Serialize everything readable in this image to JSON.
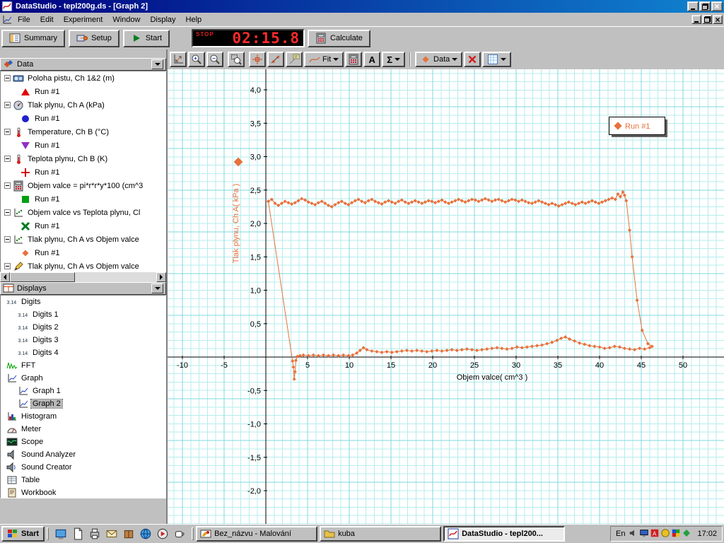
{
  "window": {
    "title": "DataStudio - tepl200g.ds - [Graph 2]"
  },
  "menubar": {
    "items": [
      "File",
      "Edit",
      "Experiment",
      "Window",
      "Display",
      "Help"
    ]
  },
  "main_toolbar": {
    "summary_label": "Summary",
    "setup_label": "Setup",
    "start_label": "Start",
    "timer": {
      "status": "STOP",
      "value": "02:15.8"
    },
    "calculate_label": "Calculate"
  },
  "graph_toolbar": {
    "fit_label": "Fit",
    "text_tool_label": "A",
    "stats_label": "Σ",
    "data_label": "Data"
  },
  "data_panel": {
    "title": "Data",
    "items": [
      {
        "icon": "motion-sensor",
        "label": "Poloha pistu, Ch 1&2 (m)",
        "runs": [
          {
            "marker": "tri-red",
            "label": "Run #1"
          }
        ]
      },
      {
        "icon": "pressure-sensor",
        "label": "Tlak plynu, Ch A (kPa)",
        "runs": [
          {
            "marker": "circle-blue",
            "label": "Run #1"
          }
        ]
      },
      {
        "icon": "temp-sensor",
        "label": "Temperature, Ch B (°C)",
        "runs": [
          {
            "marker": "tri-violet",
            "label": "Run #1"
          }
        ]
      },
      {
        "icon": "temp-sensor",
        "label": "Teplota plynu, Ch B (K)",
        "runs": [
          {
            "marker": "plus-red",
            "label": "Run #1"
          }
        ]
      },
      {
        "icon": "calculator",
        "label": "Objem valce = pi*r*r*y*100 (cm^3",
        "runs": [
          {
            "marker": "square-green",
            "label": "Run #1"
          }
        ]
      },
      {
        "icon": "xy-data",
        "label": "Objem valce vs Teplota plynu, Cl",
        "runs": [
          {
            "marker": "x-green",
            "label": "Run #1"
          }
        ]
      },
      {
        "icon": "xy-data",
        "label": "Tlak plynu, Ch A vs Objem valce",
        "runs": [
          {
            "marker": "diamond-orange",
            "label": "Run #1"
          }
        ]
      },
      {
        "icon": "pen",
        "label": "Tlak plynu, Ch A vs Objem valce",
        "runs": []
      }
    ]
  },
  "displays_panel": {
    "title": "Displays",
    "items": [
      {
        "icon": "digits",
        "label": "Digits",
        "indent": 0
      },
      {
        "icon": "digits",
        "label": "Digits 1",
        "indent": 1
      },
      {
        "icon": "digits",
        "label": "Digits 2",
        "indent": 1
      },
      {
        "icon": "digits",
        "label": "Digits 3",
        "indent": 1
      },
      {
        "icon": "digits",
        "label": "Digits 4",
        "indent": 1
      },
      {
        "icon": "fft",
        "label": "FFT",
        "indent": 0
      },
      {
        "icon": "graph",
        "label": "Graph",
        "indent": 0
      },
      {
        "icon": "graph",
        "label": "Graph 1",
        "indent": 1
      },
      {
        "icon": "graph",
        "label": "Graph 2",
        "indent": 1,
        "selected": true
      },
      {
        "icon": "histogram",
        "label": "Histogram",
        "indent": 0
      },
      {
        "icon": "meter",
        "label": "Meter",
        "indent": 0
      },
      {
        "icon": "scope",
        "label": "Scope",
        "indent": 0
      },
      {
        "icon": "speaker",
        "label": "Sound Analyzer",
        "indent": 0
      },
      {
        "icon": "speaker-wave",
        "label": "Sound Creator",
        "indent": 0
      },
      {
        "icon": "table",
        "label": "Table",
        "indent": 0
      },
      {
        "icon": "workbook",
        "label": "Workbook",
        "indent": 0
      }
    ]
  },
  "chart_data": {
    "type": "scatter",
    "line": true,
    "title": "",
    "xlabel": "Objem valce( cm^3 )",
    "ylabel": "Tlak plynu, Ch A( kPa )",
    "xlim": [
      -11.8,
      54.9
    ],
    "ylim": [
      -2.5,
      4.3
    ],
    "grid": true,
    "xticks": [
      [
        -10,
        "-10"
      ],
      [
        -5,
        "-5"
      ],
      [
        5,
        "5"
      ],
      [
        10,
        "10"
      ],
      [
        15,
        "15"
      ],
      [
        20,
        "20"
      ],
      [
        25,
        "25"
      ],
      [
        30,
        "30"
      ],
      [
        35,
        "35"
      ],
      [
        40,
        "40"
      ],
      [
        45,
        "45"
      ],
      [
        50,
        "50"
      ]
    ],
    "yticks": [
      [
        4,
        "4,0"
      ],
      [
        3.5,
        "3,5"
      ],
      [
        3,
        "3,0"
      ],
      [
        2.5,
        "2,5"
      ],
      [
        2,
        "2,0"
      ],
      [
        1.5,
        "1,5"
      ],
      [
        1,
        "1,0"
      ],
      [
        0.5,
        "0,5"
      ],
      [
        -0.5,
        "-0,5"
      ],
      [
        -1,
        "-1,0"
      ],
      [
        -1.5,
        "-1,5"
      ],
      [
        -2,
        "-2,0"
      ]
    ],
    "legend": {
      "position": "top-right",
      "entries": [
        "Run #1"
      ]
    },
    "series": [
      {
        "name": "Run #1",
        "color": "#e8713c",
        "marker": "diamond",
        "points": [
          [
            0.3,
            2.33
          ],
          [
            0.7,
            2.36
          ],
          [
            1.1,
            2.3
          ],
          [
            1.5,
            2.27
          ],
          [
            1.9,
            2.3
          ],
          [
            2.3,
            2.33
          ],
          [
            2.7,
            2.31
          ],
          [
            3.1,
            2.29
          ],
          [
            3.5,
            2.31
          ],
          [
            3.9,
            2.34
          ],
          [
            4.3,
            2.37
          ],
          [
            4.7,
            2.35
          ],
          [
            5.1,
            2.32
          ],
          [
            5.5,
            2.3
          ],
          [
            5.9,
            2.28
          ],
          [
            6.3,
            2.31
          ],
          [
            6.7,
            2.33
          ],
          [
            7.1,
            2.3
          ],
          [
            7.5,
            2.27
          ],
          [
            7.9,
            2.25
          ],
          [
            8.3,
            2.28
          ],
          [
            8.7,
            2.31
          ],
          [
            9.1,
            2.33
          ],
          [
            9.5,
            2.3
          ],
          [
            9.9,
            2.28
          ],
          [
            10.3,
            2.31
          ],
          [
            10.7,
            2.34
          ],
          [
            11.1,
            2.36
          ],
          [
            11.5,
            2.33
          ],
          [
            11.9,
            2.31
          ],
          [
            12.3,
            2.34
          ],
          [
            12.7,
            2.36
          ],
          [
            13.1,
            2.33
          ],
          [
            13.5,
            2.31
          ],
          [
            13.9,
            2.29
          ],
          [
            14.3,
            2.32
          ],
          [
            14.7,
            2.34
          ],
          [
            15.1,
            2.32
          ],
          [
            15.5,
            2.3
          ],
          [
            15.9,
            2.33
          ],
          [
            16.3,
            2.35
          ],
          [
            16.7,
            2.32
          ],
          [
            17.1,
            2.3
          ],
          [
            17.5,
            2.32
          ],
          [
            17.9,
            2.34
          ],
          [
            18.3,
            2.32
          ],
          [
            18.7,
            2.3
          ],
          [
            19.1,
            2.32
          ],
          [
            19.5,
            2.34
          ],
          [
            19.9,
            2.33
          ],
          [
            20.3,
            2.31
          ],
          [
            20.7,
            2.33
          ],
          [
            21.1,
            2.35
          ],
          [
            21.5,
            2.32
          ],
          [
            21.9,
            2.3
          ],
          [
            22.3,
            2.32
          ],
          [
            22.7,
            2.34
          ],
          [
            23.1,
            2.36
          ],
          [
            23.5,
            2.34
          ],
          [
            23.9,
            2.32
          ],
          [
            24.3,
            2.34
          ],
          [
            24.7,
            2.36
          ],
          [
            25.1,
            2.35
          ],
          [
            25.5,
            2.33
          ],
          [
            25.9,
            2.35
          ],
          [
            26.3,
            2.37
          ],
          [
            26.7,
            2.35
          ],
          [
            27.1,
            2.33
          ],
          [
            27.5,
            2.35
          ],
          [
            27.9,
            2.36
          ],
          [
            28.3,
            2.34
          ],
          [
            28.7,
            2.32
          ],
          [
            29.1,
            2.34
          ],
          [
            29.5,
            2.36
          ],
          [
            29.9,
            2.35
          ],
          [
            30.3,
            2.33
          ],
          [
            30.7,
            2.35
          ],
          [
            31.1,
            2.33
          ],
          [
            31.5,
            2.31
          ],
          [
            31.9,
            2.3
          ],
          [
            32.3,
            2.32
          ],
          [
            32.7,
            2.34
          ],
          [
            33.1,
            2.32
          ],
          [
            33.5,
            2.3
          ],
          [
            33.9,
            2.28
          ],
          [
            34.3,
            2.3
          ],
          [
            34.7,
            2.28
          ],
          [
            35.1,
            2.26
          ],
          [
            35.5,
            2.28
          ],
          [
            35.9,
            2.3
          ],
          [
            36.3,
            2.32
          ],
          [
            36.7,
            2.3
          ],
          [
            37.1,
            2.28
          ],
          [
            37.5,
            2.3
          ],
          [
            37.9,
            2.32
          ],
          [
            38.3,
            2.3
          ],
          [
            38.7,
            2.32
          ],
          [
            39.1,
            2.34
          ],
          [
            39.5,
            2.32
          ],
          [
            39.9,
            2.3
          ],
          [
            40.3,
            2.32
          ],
          [
            40.7,
            2.34
          ],
          [
            41.1,
            2.36
          ],
          [
            41.5,
            2.38
          ],
          [
            41.9,
            2.36
          ],
          [
            42.2,
            2.44
          ],
          [
            42.5,
            2.4
          ],
          [
            42.8,
            2.47
          ],
          [
            43.0,
            2.42
          ],
          [
            43.2,
            2.34
          ],
          [
            43.6,
            1.9
          ],
          [
            43.9,
            1.5
          ],
          [
            44.5,
            0.85
          ],
          [
            45.1,
            0.4
          ],
          [
            45.8,
            0.2
          ],
          [
            46.3,
            0.16
          ],
          [
            46.0,
            0.14
          ],
          [
            45.4,
            0.12
          ],
          [
            44.8,
            0.13
          ],
          [
            44.2,
            0.11
          ],
          [
            43.6,
            0.12
          ],
          [
            43.0,
            0.13
          ],
          [
            42.4,
            0.15
          ],
          [
            41.8,
            0.16
          ],
          [
            41.2,
            0.14
          ],
          [
            40.6,
            0.13
          ],
          [
            40.0,
            0.15
          ],
          [
            39.4,
            0.16
          ],
          [
            38.8,
            0.17
          ],
          [
            38.2,
            0.19
          ],
          [
            37.6,
            0.21
          ],
          [
            37.0,
            0.24
          ],
          [
            36.4,
            0.27
          ],
          [
            35.9,
            0.3
          ],
          [
            35.4,
            0.28
          ],
          [
            34.9,
            0.25
          ],
          [
            34.3,
            0.22
          ],
          [
            33.7,
            0.2
          ],
          [
            33.1,
            0.18
          ],
          [
            32.5,
            0.17
          ],
          [
            31.9,
            0.16
          ],
          [
            31.3,
            0.15
          ],
          [
            30.7,
            0.14
          ],
          [
            30.1,
            0.15
          ],
          [
            29.5,
            0.13
          ],
          [
            28.9,
            0.12
          ],
          [
            28.3,
            0.13
          ],
          [
            27.7,
            0.14
          ],
          [
            27.1,
            0.13
          ],
          [
            26.5,
            0.12
          ],
          [
            25.9,
            0.11
          ],
          [
            25.3,
            0.1
          ],
          [
            24.7,
            0.11
          ],
          [
            24.1,
            0.12
          ],
          [
            23.5,
            0.11
          ],
          [
            22.9,
            0.1
          ],
          [
            22.3,
            0.11
          ],
          [
            21.7,
            0.1
          ],
          [
            21.1,
            0.09
          ],
          [
            20.5,
            0.1
          ],
          [
            19.9,
            0.09
          ],
          [
            19.3,
            0.08
          ],
          [
            18.7,
            0.09
          ],
          [
            18.1,
            0.1
          ],
          [
            17.5,
            0.09
          ],
          [
            16.9,
            0.1
          ],
          [
            16.3,
            0.09
          ],
          [
            15.7,
            0.08
          ],
          [
            15.1,
            0.07
          ],
          [
            14.5,
            0.08
          ],
          [
            13.9,
            0.07
          ],
          [
            13.3,
            0.08
          ],
          [
            12.7,
            0.09
          ],
          [
            12.1,
            0.11
          ],
          [
            11.7,
            0.14
          ],
          [
            11.3,
            0.1
          ],
          [
            10.9,
            0.06
          ],
          [
            10.4,
            0.03
          ],
          [
            9.9,
            0.02
          ],
          [
            9.3,
            0.03
          ],
          [
            8.7,
            0.02
          ],
          [
            8.1,
            0.03
          ],
          [
            7.5,
            0.02
          ],
          [
            6.9,
            0.03
          ],
          [
            6.3,
            0.02
          ],
          [
            5.7,
            0.03
          ],
          [
            5.1,
            0.02
          ],
          [
            4.5,
            0.03
          ],
          [
            4.1,
            0.02
          ],
          [
            3.8,
            0.01
          ],
          [
            3.6,
            -0.05
          ],
          [
            3.5,
            -0.22
          ],
          [
            3.4,
            -0.33
          ],
          [
            3.3,
            -0.15
          ],
          [
            3.2,
            -0.06
          ],
          [
            0.3,
            2.33
          ]
        ]
      }
    ]
  },
  "taskbar": {
    "start_label": "Start",
    "quick_launch": [
      "desktop",
      "document",
      "printer",
      "mail",
      "package",
      "globe",
      "media",
      "coffee"
    ],
    "tasks": [
      {
        "icon": "paint",
        "label": "Bez_názvu - Malování",
        "active": false
      },
      {
        "icon": "folder",
        "label": "kuba",
        "active": false
      },
      {
        "icon": "datastudio",
        "label": "DataStudio - tepl200...",
        "active": true
      }
    ],
    "tray": {
      "lang": "En",
      "icons": [
        "volume",
        "monitor",
        "red-badge",
        "yellow-badge",
        "multi-badge",
        "green-badge"
      ],
      "time": "17:02"
    }
  }
}
